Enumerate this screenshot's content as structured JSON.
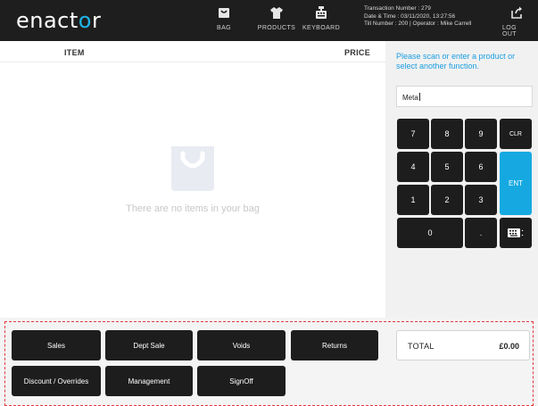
{
  "header": {
    "logo_prefix": "enact",
    "logo_o": "o",
    "logo_suffix": "r",
    "nav": [
      {
        "label": "BAG",
        "icon": "bag-icon"
      },
      {
        "label": "PRODUCTS",
        "icon": "tshirt-icon"
      },
      {
        "label": "KEYBOARD",
        "icon": "cash-register-icon"
      }
    ],
    "transaction": {
      "line1": "Transaction Number : 279",
      "line2": "Date & Time : 03/11/2020, 13:27:56",
      "line3": "Till Number : 200  |  Operator : Mike Carrell"
    },
    "logout_label": "LOG OUT",
    "logout_icon": "logout-icon"
  },
  "bag": {
    "col_item": "ITEM",
    "col_price": "PRICE",
    "empty_message": "There are no items in your bag",
    "empty_icon": "shopping-bag-icon"
  },
  "entry": {
    "prompt": "Please scan or enter a product or select another function.",
    "input_value": "Meta"
  },
  "keypad": {
    "k7": "7",
    "k8": "8",
    "k9": "9",
    "clr": "CLR",
    "k4": "4",
    "k5": "5",
    "k6": "6",
    "ent": "ENT",
    "k1": "1",
    "k2": "2",
    "k3": "3",
    "k0": "0",
    "dot": ".",
    "keyboard_icon": "keyboard-icon"
  },
  "functions": {
    "sales": "Sales",
    "dept_sale": "Dept Sale",
    "voids": "Voids",
    "returns": "Returns",
    "discount": "Discount / Overrides",
    "management": "Management",
    "signoff": "SignOff"
  },
  "total": {
    "label": "TOTAL",
    "value": "£0.00"
  },
  "colors": {
    "accent": "#16a9e1",
    "header_bg": "#1e1e1e",
    "key_bg": "#1d1d1d",
    "dashed_outline": "#e0393e"
  }
}
